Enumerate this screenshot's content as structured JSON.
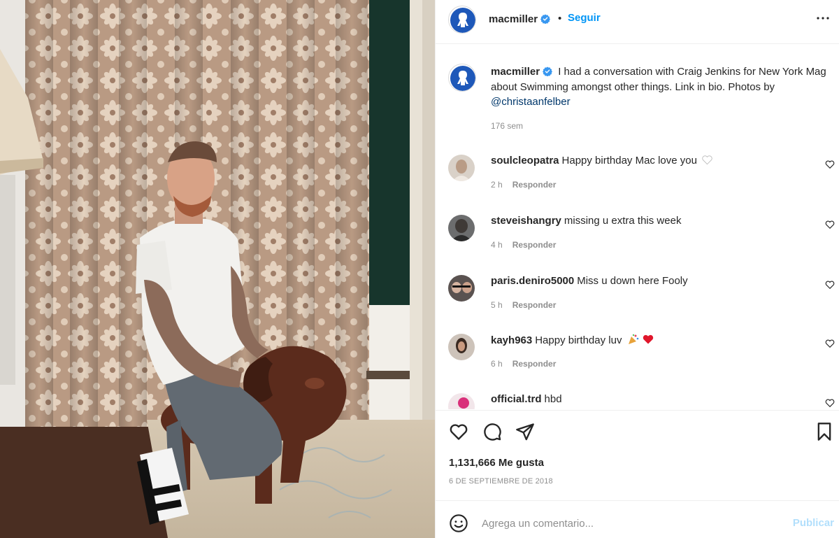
{
  "post": {
    "username": "macmiller",
    "follow_label": "Seguir",
    "separator": "•",
    "verified_icon": "verified-badge-icon",
    "more_icon": "more-options-icon"
  },
  "caption": {
    "username": "macmiller",
    "text": "I had a conversation with Craig Jenkins for New York Mag about Swimming amongst other things. Link in bio. Photos by",
    "mention": "@christaanfelber",
    "time": "176 sem"
  },
  "comments": [
    {
      "username": "soulcleopatra",
      "text": "Happy birthday Mac love you",
      "suffix_icon": "white-heart-emoji",
      "time": "2 h",
      "reply_label": "Responder"
    },
    {
      "username": "steveishangry",
      "text": "missing u extra this week",
      "time": "4 h",
      "reply_label": "Responder"
    },
    {
      "username": "paris.deniro5000",
      "text": "Miss u down here Fooly",
      "time": "5 h",
      "reply_label": "Responder"
    },
    {
      "username": "kayh963",
      "text": "Happy birthday luv",
      "suffix_icon": "party-popper-and-red-heart-emoji",
      "time": "6 h",
      "reply_label": "Responder"
    },
    {
      "username": "official.trd",
      "text": "hbd",
      "time": "",
      "reply_label": ""
    }
  ],
  "actions": {
    "like_icon": "heart-icon",
    "comment_icon": "comment-icon",
    "share_icon": "share-icon",
    "save_icon": "bookmark-icon",
    "likes_count": "1,131,666",
    "likes_label": "Me gusta",
    "date": "6 DE SEPTIEMBRE DE 2018"
  },
  "composer": {
    "emoji_icon": "smiley-icon",
    "placeholder": "Agrega un comentario...",
    "post_label": "Publicar"
  },
  "colors": {
    "link_blue": "#0095f6",
    "post_disabled": "#b2dffc",
    "verified_blue": "#3897f0",
    "muted": "#8e8e8e"
  }
}
